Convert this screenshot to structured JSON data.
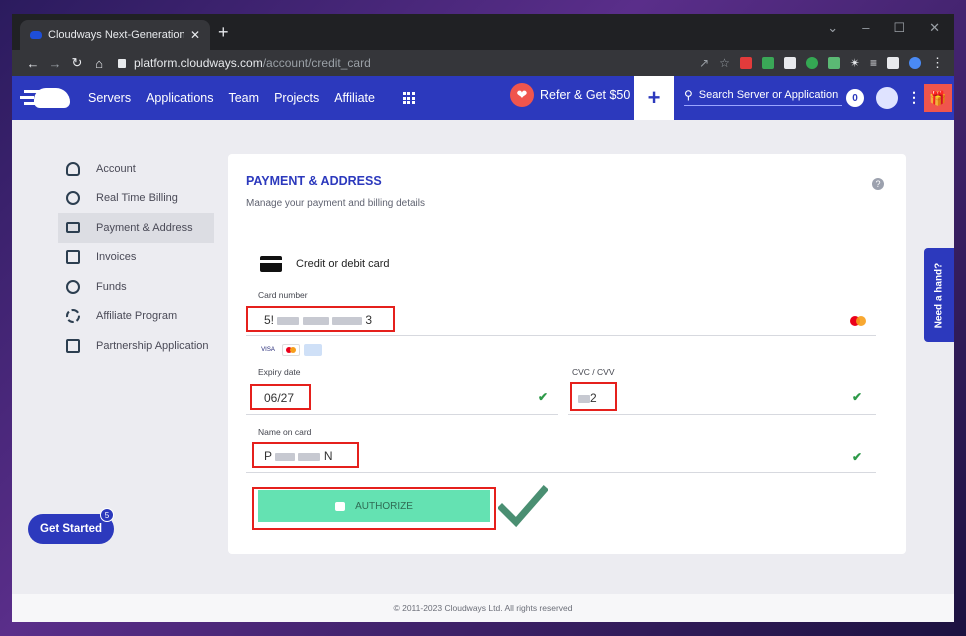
{
  "browser": {
    "tab_title": "Cloudways Next-Generation Clé",
    "tab_close": "✕",
    "new_tab": "+",
    "url_host": "platform.cloudways.com",
    "url_path": "/account/credit_card",
    "window_controls": [
      "–",
      "☐",
      "✕"
    ]
  },
  "header": {
    "nav": [
      "Servers",
      "Applications",
      "Team",
      "Projects",
      "Affiliate"
    ],
    "refer_label": "Refer & Get $50",
    "add_label": "+",
    "search_placeholder": "Search Server or Application",
    "notification_count": "0",
    "kebab": "⋮",
    "gift": "☰"
  },
  "sidebar": {
    "items": [
      {
        "label": "Account",
        "icon": "user-icon"
      },
      {
        "label": "Real Time Billing",
        "icon": "clock-icon"
      },
      {
        "label": "Payment & Address",
        "icon": "credit-card-icon",
        "active": true
      },
      {
        "label": "Invoices",
        "icon": "invoice-icon"
      },
      {
        "label": "Funds",
        "icon": "dollar-icon"
      },
      {
        "label": "Affiliate Program",
        "icon": "target-icon"
      },
      {
        "label": "Partnership Application",
        "icon": "partnership-icon"
      }
    ]
  },
  "card": {
    "title": "PAYMENT & ADDRESS",
    "subtitle": "Manage your payment and billing details",
    "help": "?",
    "payment_method": "Credit or debit card",
    "card_number_label": "Card number",
    "card_number_start": "5!",
    "card_number_end": "3",
    "brand_visa": "VISA",
    "expiry_label": "Expiry date",
    "expiry_value": "06/27",
    "cvc_label": "CVC / CVV",
    "cvc_end": "2",
    "name_label": "Name on card",
    "name_start": "P",
    "name_end": "N",
    "check": "✔",
    "authorize_label": "AUTHORIZE"
  },
  "widgets": {
    "need_hand": "Need a hand?",
    "get_started": "Get Started",
    "get_started_badge": "5"
  },
  "footer": {
    "text": "© 2011-2023 Cloudways Ltd. All rights reserved"
  },
  "colors": {
    "brand_blue": "#2c39bd",
    "accent_red": "#f0554d",
    "authorize_green": "#64e2b2",
    "check_green": "#2e9a49",
    "highlight_red": "#e5201c"
  }
}
